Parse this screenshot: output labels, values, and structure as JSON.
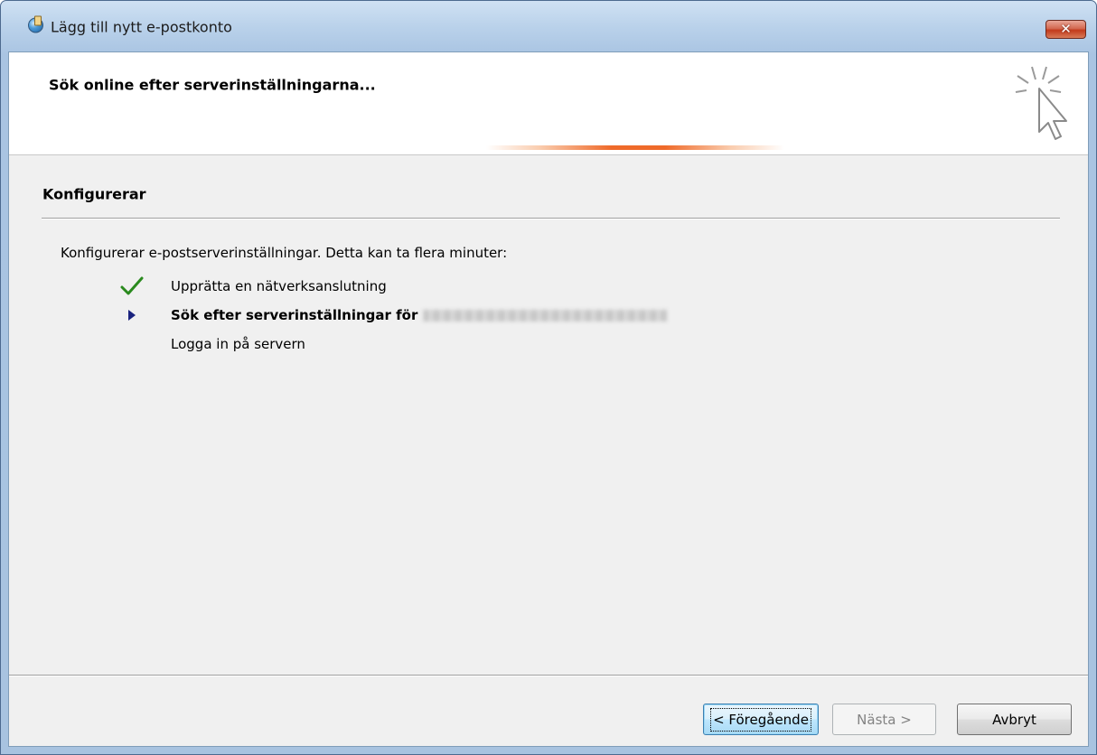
{
  "window": {
    "title": "Lägg till nytt e-postkonto",
    "close_glyph": "✕"
  },
  "header": {
    "title": "Sök online efter serverinställningarna..."
  },
  "section": {
    "title": "Konfigurerar",
    "intro": "Konfigurerar e-postserverinställningar. Detta kan ta flera minuter:"
  },
  "steps": [
    {
      "label": "Upprätta en nätverksanslutning",
      "state": "done",
      "icon": "checkmark-icon"
    },
    {
      "label": "Sök efter serverinställningar för",
      "state": "active",
      "icon": "arrow-right-icon"
    },
    {
      "label": "Logga in på servern",
      "state": "pending",
      "icon": ""
    }
  ],
  "buttons": {
    "back": "< Föregående",
    "next": "Nästa >",
    "cancel": "Avbryt"
  },
  "colors": {
    "check": "#2a8a1e",
    "arrow": "#1a237e",
    "progress": "#ef6a2a"
  }
}
